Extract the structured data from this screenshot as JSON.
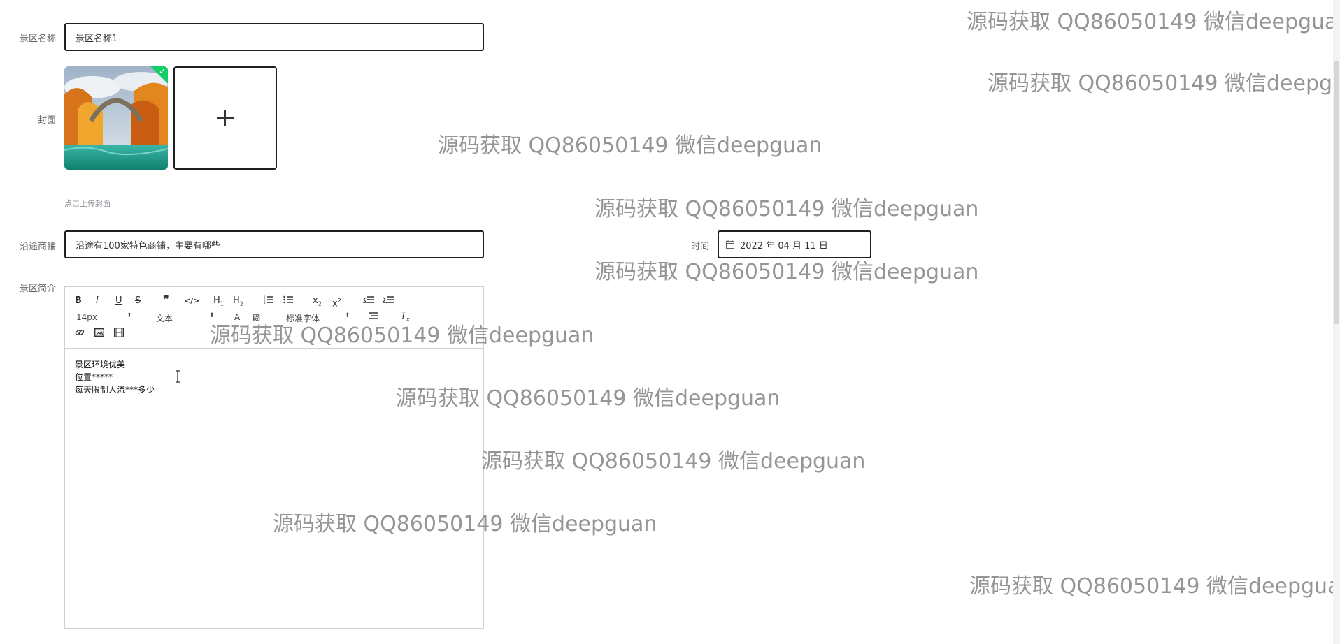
{
  "form": {
    "name": {
      "label": "景区名称",
      "value": "景区名称1"
    },
    "cover": {
      "label": "封面",
      "hint": "点击上传封面"
    },
    "shops": {
      "label": "沿途商铺",
      "value": "沿途有100家特色商铺，主要有哪些"
    },
    "time": {
      "label": "时间",
      "value": "2022 年 04 月 11 日",
      "icon": "calendar-icon"
    },
    "intro": {
      "label": "景区简介"
    }
  },
  "editor": {
    "toolbar_row1": [
      "B",
      "I",
      "U",
      "S",
      "99",
      "</>",
      "H1",
      "H2",
      "ordered-list",
      "bullet-list",
      "X2",
      "X2",
      "outdent",
      "indent"
    ],
    "font_size": "14px",
    "text_style": "文本",
    "font_family": "标准字体",
    "content": [
      "景区环境优美",
      "位置*****",
      "每天限制人流***多少"
    ]
  },
  "watermarks": {
    "text": "源码获取 QQ86050149 微信deepguan"
  },
  "colors": {
    "success": "#13ce66",
    "border": "#1f1f1f",
    "label": "#606266"
  }
}
